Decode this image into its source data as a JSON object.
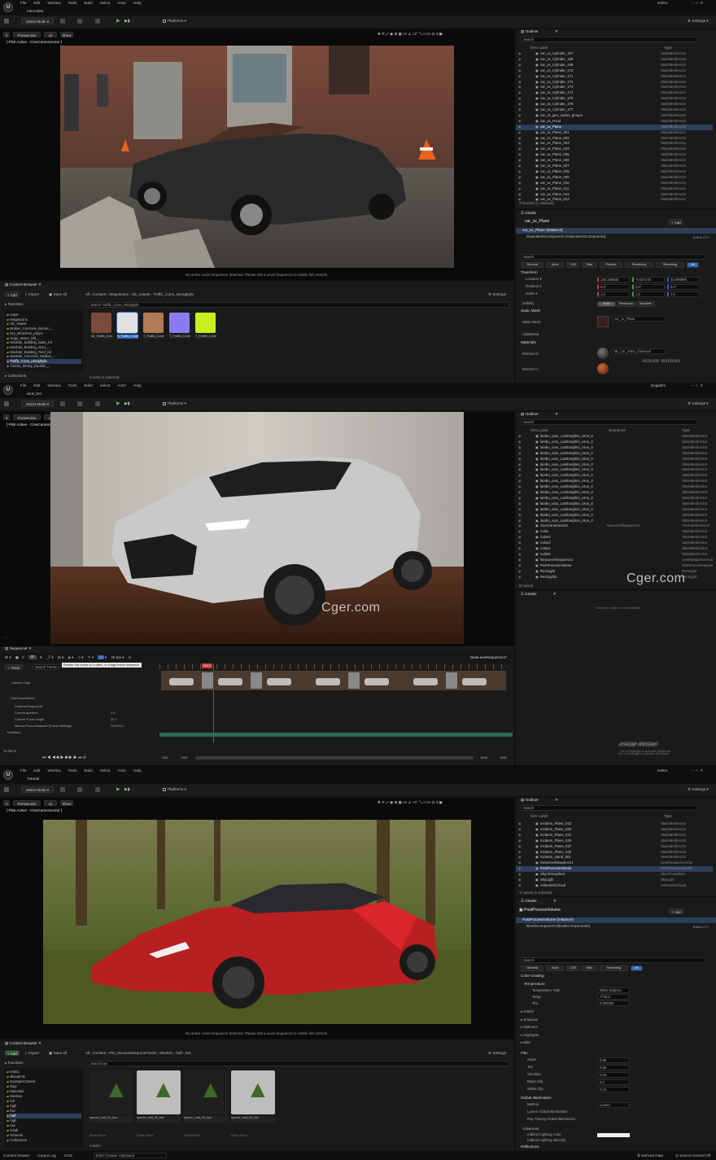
{
  "menu_items": [
    "File",
    "Edit",
    "Window",
    "Tools",
    "Build",
    "Select",
    "Actor",
    "Help"
  ],
  "shared": {
    "select_mode": "Select Mode",
    "platforms": "Platforms",
    "settings": "Settings",
    "perspective": "Perspective",
    "lit": "Lit",
    "show": "Show",
    "outliner": "Outliner",
    "details": "Details",
    "search": "Search",
    "item_label": "Item Label",
    "type": "Type",
    "add": "+ Add",
    "content_browser": "Content Browser",
    "import": "Import",
    "save_all": "Save All",
    "favorites": "Favorites",
    "collections": "Collections",
    "pilot_active": "[ Pilot Active - CineCameraActor ]",
    "no_sequencer": "No active Level Sequencer detected. Please edit a Level Sequence to enable full controls.",
    "activate_windows": "Activate Windows",
    "activate_windows_sub": "Go to Settings to activate Windows.",
    "watermark": "Cger.com",
    "edit_in_cpp": "Edit in C++"
  },
  "screen1": {
    "level_tab": "mercedes",
    "user": "test01",
    "outliner_rows": [
      {
        "name": "car_xx_Cylinder_167",
        "type": "StaticMeshActor"
      },
      {
        "name": "car_xx_Cylinder_168",
        "type": "StaticMeshActor"
      },
      {
        "name": "car_xx_Cylinder_169",
        "type": "StaticMeshActor"
      },
      {
        "name": "car_xx_Cylinder_170",
        "type": "StaticMeshActor"
      },
      {
        "name": "car_xx_Cylinder_171",
        "type": "StaticMeshActor"
      },
      {
        "name": "car_xx_Cylinder_172",
        "type": "StaticMeshActor"
      },
      {
        "name": "car_xx_Cylinder_173",
        "type": "StaticMeshActor"
      },
      {
        "name": "car_xx_Cylinder_174",
        "type": "StaticMeshActor"
      },
      {
        "name": "car_xx_Cylinder_175",
        "type": "StaticMeshActor"
      },
      {
        "name": "car_xx_Cylinder_176",
        "type": "StaticMeshActor"
      },
      {
        "name": "car_xx_Cylinder_177",
        "type": "StaticMeshActor"
      },
      {
        "name": "car_xx_geo_nodes_groups",
        "type": "StaticMeshActor"
      },
      {
        "name": "car_xx_Hood",
        "type": "StaticMeshActor"
      },
      {
        "name": "car_xx_Plane",
        "type": "StaticMeshActor"
      },
      {
        "name": "car_xx_Plane_001",
        "type": "StaticMeshActor"
      },
      {
        "name": "car_xx_Plane_002",
        "type": "StaticMeshActor"
      },
      {
        "name": "car_xx_Plane_003",
        "type": "StaticMeshActor"
      },
      {
        "name": "car_xx_Plane_004",
        "type": "StaticMeshActor"
      },
      {
        "name": "car_xx_Plane_005",
        "type": "StaticMeshActor"
      },
      {
        "name": "car_xx_Plane_006",
        "type": "StaticMeshActor"
      },
      {
        "name": "car_xx_Plane_007",
        "type": "StaticMeshActor"
      },
      {
        "name": "car_xx_Plane_008",
        "type": "StaticMeshActor"
      },
      {
        "name": "car_xx_Plane_009",
        "type": "StaticMeshActor"
      },
      {
        "name": "car_xx_Plane_010",
        "type": "StaticMeshActor"
      },
      {
        "name": "car_xx_Plane_011",
        "type": "StaticMeshActor"
      },
      {
        "name": "car_xx_Plane_012",
        "type": "StaticMeshActor"
      },
      {
        "name": "car_xx_Plane_013",
        "type": "StaticMeshActor"
      }
    ],
    "actor_count": "276 actors (1 selected)",
    "details_title": "car_xx_Plane",
    "instance_label": "car_xx_Plane (Instance)",
    "component_label": "StaticMeshComponent (StaticMeshComponent)",
    "detail_tabs": [
      "General",
      "Actor",
      "LOD",
      "Misc",
      "Physics",
      "Rendering",
      "Streaming",
      "All"
    ],
    "transform_header": "Transform",
    "transform_rows": [
      {
        "label": "Location",
        "x": "135.156640",
        "y": "-6.637278",
        "z": "50.096999"
      },
      {
        "label": "Rotation",
        "x": "0.0°",
        "y": "0.0°",
        "z": "0.0°"
      },
      {
        "label": "Scale",
        "x": "1.0",
        "y": "1.0",
        "z": "1.0"
      }
    ],
    "mobility": {
      "label": "Mobility",
      "options": [
        "Static",
        "Stationary",
        "Movable"
      ]
    },
    "static_mesh_header": "Static Mesh",
    "static_mesh_label": "Static Mesh",
    "static_mesh_value": "car_xx_Plane",
    "advanced": "Advanced",
    "materials_header": "Materials",
    "element0": "Element 0",
    "element0_value": "MI_Car_Paint_Charcoal",
    "element1": "Element 1",
    "cb_path": [
      "All",
      "Content",
      "Megascans",
      "3D_Assets",
      "Traffic_Cone_uknzgbyfa"
    ],
    "cb_search": "Search Traffic_Cone_uknzgbyfa",
    "cb_tree": [
      "maps",
      "Megascans",
      "3D_Assets",
      "Broken_Concrete_Barrier_...",
      "Dry_Branches_pdye3",
      "Huge_Stone_Hill_...",
      "Modular_Building_Base_Kit",
      "Modular_Building_Door_...",
      "Modular_Building_Roof_Kit",
      "Modular_Concrete_Median_...",
      "Traffic_Cone_uknzgbyfa",
      "Tundra_Mossy_Boulder_..."
    ],
    "cb_items": [
      {
        "label": "MI_Traffic_Cone_...",
        "color": "#7a4a3a"
      },
      {
        "label": "S_Traffic_Cone_...",
        "color": "#e0e0e0"
      },
      {
        "label": "T_Traffic_Cone_...",
        "color": "#b07a55"
      },
      {
        "label": "T_Traffic_Cone_...",
        "color": "#8a7cf0"
      },
      {
        "label": "T_Traffic_Cone_...",
        "color": "#c7ee1f"
      }
    ],
    "cb_count": "5 items (1 selected)"
  },
  "screen2": {
    "level_tab": "urus_bot",
    "user": "Bugati01",
    "outliner_col_sequence": "Sequence",
    "outliner_rows": [
      {
        "name": "lambo_urus_Lamborghini_Urus_0",
        "type": "StaticMeshActor",
        "seq": ""
      },
      {
        "name": "lambo_urus_Lamborghini_Urus_0",
        "type": "StaticMeshActor",
        "seq": ""
      },
      {
        "name": "lambo_urus_Lamborghini_Urus_0",
        "type": "StaticMeshActor",
        "seq": ""
      },
      {
        "name": "lambo_urus_Lamborghini_Urus_0",
        "type": "StaticMeshActor",
        "seq": ""
      },
      {
        "name": "lambo_urus_Lamborghini_Urus_0",
        "type": "StaticMeshActor",
        "seq": ""
      },
      {
        "name": "lambo_urus_Lamborghini_Urus_0",
        "type": "StaticMeshActor",
        "seq": ""
      },
      {
        "name": "lambo_urus_Lamborghini_Urus_0",
        "type": "StaticMeshActor",
        "seq": ""
      },
      {
        "name": "lambo_urus_Lamborghini_Urus_0",
        "type": "StaticMeshActor",
        "seq": ""
      },
      {
        "name": "lambo_urus_Lamborghini_Urus_0",
        "type": "StaticMeshActor",
        "seq": ""
      },
      {
        "name": "lambo_urus_Lamborghini_Urus_0",
        "type": "StaticMeshActor",
        "seq": ""
      },
      {
        "name": "lambo_urus_Lamborghini_Urus_0",
        "type": "StaticMeshActor",
        "seq": ""
      },
      {
        "name": "lambo_urus_Lamborghini_Urus_0",
        "type": "StaticMeshActor",
        "seq": ""
      },
      {
        "name": "lambo_urus_Lamborghini_Urus_0",
        "type": "StaticMeshActor",
        "seq": ""
      },
      {
        "name": "lambo_urus_Lamborghini_Urus_0",
        "type": "StaticMeshActor",
        "seq": ""
      },
      {
        "name": "lambo_urus_Lamborghini_Urus_0",
        "type": "StaticMeshActor",
        "seq": ""
      },
      {
        "name": "lambo_urus_Lamborghini_Urus_0",
        "type": "StaticMeshActor",
        "seq": ""
      },
      {
        "name": "CineCameraActor",
        "type": "CineCameraActor",
        "seq": "NewLevelSequence1"
      },
      {
        "name": "Cube",
        "type": "StaticMeshActor",
        "seq": ""
      },
      {
        "name": "Cube2",
        "type": "StaticMeshActor",
        "seq": ""
      },
      {
        "name": "Cube3",
        "type": "StaticMeshActor",
        "seq": ""
      },
      {
        "name": "Cube4",
        "type": "StaticMeshActor",
        "seq": ""
      },
      {
        "name": "Cube5",
        "type": "StaticMeshActor",
        "seq": ""
      },
      {
        "name": "NewLevelSequence1",
        "type": "LevelSequenceActor",
        "seq": ""
      },
      {
        "name": "PostProcessVolume",
        "type": "PostProcessVolume",
        "seq": ""
      },
      {
        "name": "RectLight",
        "type": "RectLight",
        "seq": ""
      },
      {
        "name": "RectLight2",
        "type": "RectLight",
        "seq": ""
      }
    ],
    "actor_count": "87 actors",
    "details_empty": "Select an object to view details.",
    "sequencer_title": "Sequencer",
    "fps": "30 fps",
    "sequence_name": "NewLevelSequence1*",
    "track_button": "+ Track",
    "filter_placeholder": "Search Tracks",
    "tooltip": "Render this movie to a video, or image frame sequence.",
    "current_frame": "0013",
    "tracks": [
      {
        "label": "Camera Cuts",
        "value": ""
      },
      {
        "label": "CineCameraActor",
        "value": ""
      },
      {
        "label": "CameraComponent",
        "value": ""
      },
      {
        "label": "Current Aperture",
        "value": "2.8"
      },
      {
        "label": "Current Focal Length",
        "value": "35.0"
      },
      {
        "label": "Manual Focus Distance (Focus Settings)",
        "value": "100000.0"
      },
      {
        "label": "Transform",
        "value": ""
      }
    ],
    "item_count": "15 items",
    "range_start": "-015",
    "range_start2": "-015",
    "range_end": "1000",
    "range_end2": "1000"
  },
  "screen3": {
    "level_tab": "Tutorial",
    "user": "test01",
    "outliner_rows": [
      {
        "name": "mclaren_Plane_022",
        "type": "StaticMeshActor"
      },
      {
        "name": "mclaren_Plane_030",
        "type": "StaticMeshActor"
      },
      {
        "name": "mclaren_Plane_031",
        "type": "StaticMeshActor"
      },
      {
        "name": "mclaren_Plane_034",
        "type": "StaticMeshActor"
      },
      {
        "name": "mclaren_Plane_037",
        "type": "StaticMeshActor"
      },
      {
        "name": "mclaren_Plane_042",
        "type": "StaticMeshActor"
      },
      {
        "name": "mclaren_stand_001",
        "type": "StaticMeshActor"
      },
      {
        "name": "NewLevelSequence1",
        "type": "LevelSequenceActor"
      },
      {
        "name": "PostProcessVolume",
        "type": "PostProcessVolume"
      },
      {
        "name": "SkyAtmosphere",
        "type": "SkyAtmosphere"
      },
      {
        "name": "SkyLight",
        "type": "SkyLight"
      },
      {
        "name": "VolumetricCloud",
        "type": "VolumetricCloud"
      }
    ],
    "actor_count": "17 actors (1 selected)",
    "details_title": "PostProcessVolume",
    "instance_label": "PostProcessVolume (Instance)",
    "component_label": "BrushComponent (BrushComponent0)",
    "detail_tabs": [
      "General",
      "Actor",
      "LOD",
      "Misc",
      "Streaming",
      "All"
    ],
    "color_grading": "Color Grading",
    "temperature": "Temperature",
    "temp_type": {
      "label": "Temperature Type",
      "value": "White Balance"
    },
    "temp_temp": {
      "label": "Temp",
      "value": "7748.5"
    },
    "temp_tint": {
      "label": "Tint",
      "value": "0.000000"
    },
    "sections": [
      "Global",
      "Shadows",
      "Midtones",
      "Highlights",
      "Misc"
    ],
    "film": "Film",
    "film_rows": [
      {
        "label": "Slope",
        "value": "0.88"
      },
      {
        "label": "Toe",
        "value": "0.55"
      },
      {
        "label": "Shoulder",
        "value": "0.26"
      },
      {
        "label": "Black Clip",
        "value": "0.0"
      },
      {
        "label": "White Clip",
        "value": "0.04"
      }
    ],
    "gi": "Global Illumination",
    "gi_rows": [
      {
        "label": "Method",
        "value": "Lumen"
      },
      {
        "label": "Lumen Global Illumination",
        "value": ""
      },
      {
        "label": "Ray Tracing Global Illumination",
        "value": ""
      }
    ],
    "advanced": "Advanced",
    "indirect_color": "Indirect Lighting Color",
    "indirect_intensity": "Indirect Lighting Intensity",
    "reflections": "Reflections",
    "cb_path": [
      "All",
      "Content",
      "PN_InteractiveSpruceForest",
      "Meshes",
      "half",
      "low"
    ],
    "cb_search": "Search low",
    "cb_tree": [
      "test01",
      "Blueprints",
      "ExampleContent",
      "Map",
      "Materials",
      "Meshes",
      "full",
      "high",
      "low",
      "half",
      "high",
      "low",
      "small",
      "Textures",
      "Collections"
    ],
    "cb_items": [
      {
        "label": "spruce_half_01_low"
      },
      {
        "label": "spruce_half_02_low"
      },
      {
        "label": "spruce_half_03_low"
      },
      {
        "label": "spruce_half_04_low"
      }
    ],
    "cb_item_type": "Static Mesh",
    "cb_count": "4 items",
    "status": [
      "Content Drawer",
      "Output Log",
      "Cmd"
    ],
    "console_placeholder": "Enter Console Command",
    "derived_data": "Derived Data",
    "source_control": "Source Control Off"
  }
}
